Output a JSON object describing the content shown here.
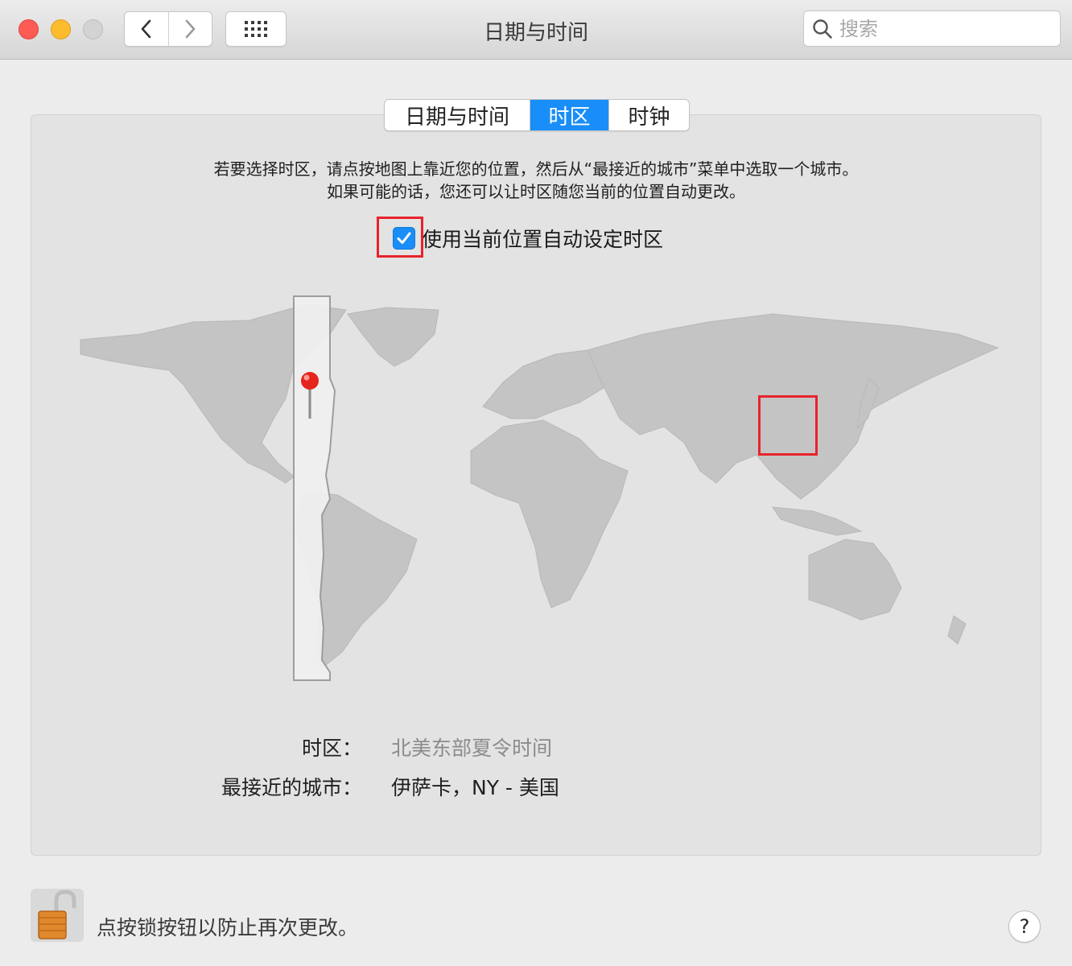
{
  "window": {
    "title": "日期与时间"
  },
  "toolbar": {
    "search_placeholder": "搜索"
  },
  "tabs": [
    {
      "label": "日期与时间",
      "selected": false
    },
    {
      "label": "时区",
      "selected": true
    },
    {
      "label": "时钟",
      "selected": false
    }
  ],
  "instructions": {
    "line1": "若要选择时区，请点按地图上靠近您的位置，然后从“最接近的城市”菜单中选取一个城市。",
    "line2": "如果可能的话，您还可以让时区随您当前的位置自动更改。"
  },
  "auto_timezone": {
    "label": "使用当前位置自动设定时区",
    "checked": true
  },
  "info": {
    "timezone_label": "时区：",
    "timezone_value": "北美东部夏令时间",
    "city_label": "最接近的城市：",
    "city_value": "伊萨卡，NY - 美国"
  },
  "footer": {
    "lock_text": "点按锁按钮以防止再次更改。",
    "help_label": "?"
  },
  "colors": {
    "accent": "#1a8ef8",
    "highlight": "#e8232a",
    "land": "#c4c4c4",
    "selected_zone": "#f0f0f0"
  }
}
